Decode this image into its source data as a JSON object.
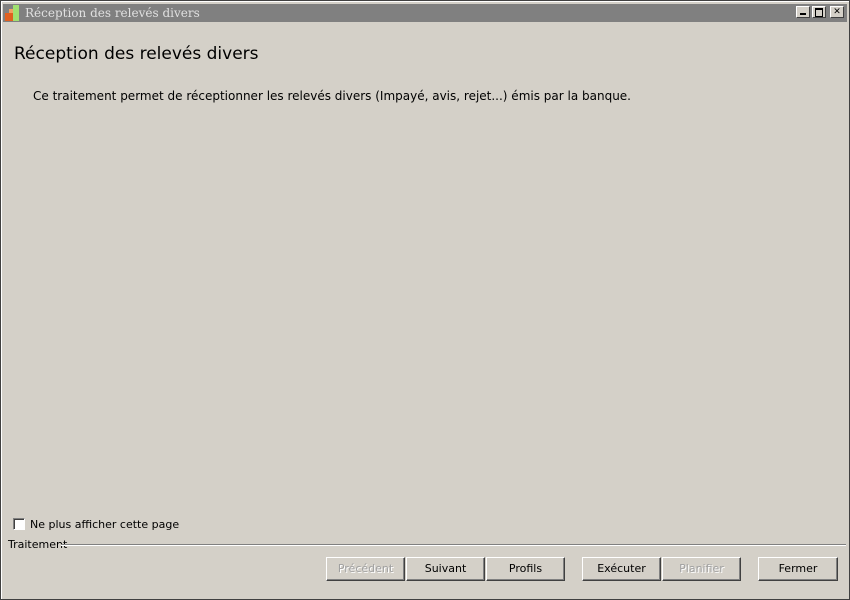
{
  "window": {
    "title": "Réception des relevés divers"
  },
  "content": {
    "heading": "Réception des relevés divers",
    "description": "Ce traitement permet de réceptionner les relevés divers (Impayé, avis, rejet...) émis par la banque."
  },
  "options": {
    "hide_page_label": "Ne plus afficher cette page",
    "hide_page_checked": false
  },
  "footer": {
    "group_label": "Traitement",
    "buttons": {
      "previous": "Précédent",
      "next": "Suivant",
      "profiles": "Profils",
      "execute": "Exécuter",
      "schedule": "Planifier",
      "close": "Fermer"
    }
  }
}
